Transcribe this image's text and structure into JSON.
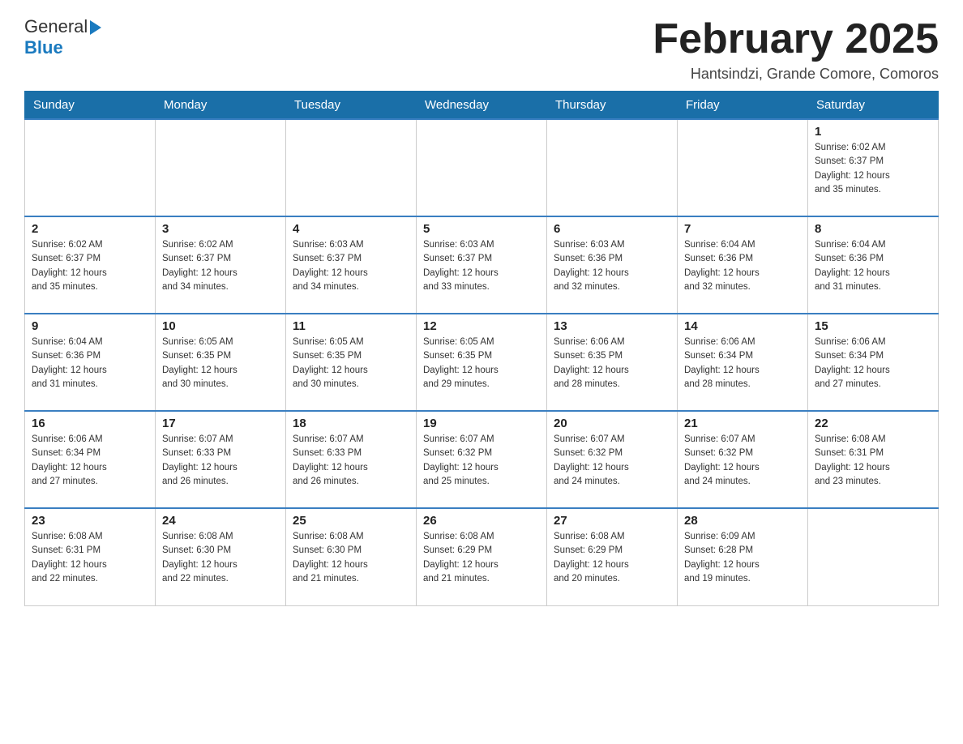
{
  "header": {
    "logo_line1": "General",
    "logo_line2": "Blue",
    "month_title": "February 2025",
    "subtitle": "Hantsindzi, Grande Comore, Comoros"
  },
  "days_of_week": [
    "Sunday",
    "Monday",
    "Tuesday",
    "Wednesday",
    "Thursday",
    "Friday",
    "Saturday"
  ],
  "weeks": [
    [
      {
        "day": "",
        "info": ""
      },
      {
        "day": "",
        "info": ""
      },
      {
        "day": "",
        "info": ""
      },
      {
        "day": "",
        "info": ""
      },
      {
        "day": "",
        "info": ""
      },
      {
        "day": "",
        "info": ""
      },
      {
        "day": "1",
        "info": "Sunrise: 6:02 AM\nSunset: 6:37 PM\nDaylight: 12 hours\nand 35 minutes."
      }
    ],
    [
      {
        "day": "2",
        "info": "Sunrise: 6:02 AM\nSunset: 6:37 PM\nDaylight: 12 hours\nand 35 minutes."
      },
      {
        "day": "3",
        "info": "Sunrise: 6:02 AM\nSunset: 6:37 PM\nDaylight: 12 hours\nand 34 minutes."
      },
      {
        "day": "4",
        "info": "Sunrise: 6:03 AM\nSunset: 6:37 PM\nDaylight: 12 hours\nand 34 minutes."
      },
      {
        "day": "5",
        "info": "Sunrise: 6:03 AM\nSunset: 6:37 PM\nDaylight: 12 hours\nand 33 minutes."
      },
      {
        "day": "6",
        "info": "Sunrise: 6:03 AM\nSunset: 6:36 PM\nDaylight: 12 hours\nand 32 minutes."
      },
      {
        "day": "7",
        "info": "Sunrise: 6:04 AM\nSunset: 6:36 PM\nDaylight: 12 hours\nand 32 minutes."
      },
      {
        "day": "8",
        "info": "Sunrise: 6:04 AM\nSunset: 6:36 PM\nDaylight: 12 hours\nand 31 minutes."
      }
    ],
    [
      {
        "day": "9",
        "info": "Sunrise: 6:04 AM\nSunset: 6:36 PM\nDaylight: 12 hours\nand 31 minutes."
      },
      {
        "day": "10",
        "info": "Sunrise: 6:05 AM\nSunset: 6:35 PM\nDaylight: 12 hours\nand 30 minutes."
      },
      {
        "day": "11",
        "info": "Sunrise: 6:05 AM\nSunset: 6:35 PM\nDaylight: 12 hours\nand 30 minutes."
      },
      {
        "day": "12",
        "info": "Sunrise: 6:05 AM\nSunset: 6:35 PM\nDaylight: 12 hours\nand 29 minutes."
      },
      {
        "day": "13",
        "info": "Sunrise: 6:06 AM\nSunset: 6:35 PM\nDaylight: 12 hours\nand 28 minutes."
      },
      {
        "day": "14",
        "info": "Sunrise: 6:06 AM\nSunset: 6:34 PM\nDaylight: 12 hours\nand 28 minutes."
      },
      {
        "day": "15",
        "info": "Sunrise: 6:06 AM\nSunset: 6:34 PM\nDaylight: 12 hours\nand 27 minutes."
      }
    ],
    [
      {
        "day": "16",
        "info": "Sunrise: 6:06 AM\nSunset: 6:34 PM\nDaylight: 12 hours\nand 27 minutes."
      },
      {
        "day": "17",
        "info": "Sunrise: 6:07 AM\nSunset: 6:33 PM\nDaylight: 12 hours\nand 26 minutes."
      },
      {
        "day": "18",
        "info": "Sunrise: 6:07 AM\nSunset: 6:33 PM\nDaylight: 12 hours\nand 26 minutes."
      },
      {
        "day": "19",
        "info": "Sunrise: 6:07 AM\nSunset: 6:32 PM\nDaylight: 12 hours\nand 25 minutes."
      },
      {
        "day": "20",
        "info": "Sunrise: 6:07 AM\nSunset: 6:32 PM\nDaylight: 12 hours\nand 24 minutes."
      },
      {
        "day": "21",
        "info": "Sunrise: 6:07 AM\nSunset: 6:32 PM\nDaylight: 12 hours\nand 24 minutes."
      },
      {
        "day": "22",
        "info": "Sunrise: 6:08 AM\nSunset: 6:31 PM\nDaylight: 12 hours\nand 23 minutes."
      }
    ],
    [
      {
        "day": "23",
        "info": "Sunrise: 6:08 AM\nSunset: 6:31 PM\nDaylight: 12 hours\nand 22 minutes."
      },
      {
        "day": "24",
        "info": "Sunrise: 6:08 AM\nSunset: 6:30 PM\nDaylight: 12 hours\nand 22 minutes."
      },
      {
        "day": "25",
        "info": "Sunrise: 6:08 AM\nSunset: 6:30 PM\nDaylight: 12 hours\nand 21 minutes."
      },
      {
        "day": "26",
        "info": "Sunrise: 6:08 AM\nSunset: 6:29 PM\nDaylight: 12 hours\nand 21 minutes."
      },
      {
        "day": "27",
        "info": "Sunrise: 6:08 AM\nSunset: 6:29 PM\nDaylight: 12 hours\nand 20 minutes."
      },
      {
        "day": "28",
        "info": "Sunrise: 6:09 AM\nSunset: 6:28 PM\nDaylight: 12 hours\nand 19 minutes."
      },
      {
        "day": "",
        "info": ""
      }
    ]
  ]
}
